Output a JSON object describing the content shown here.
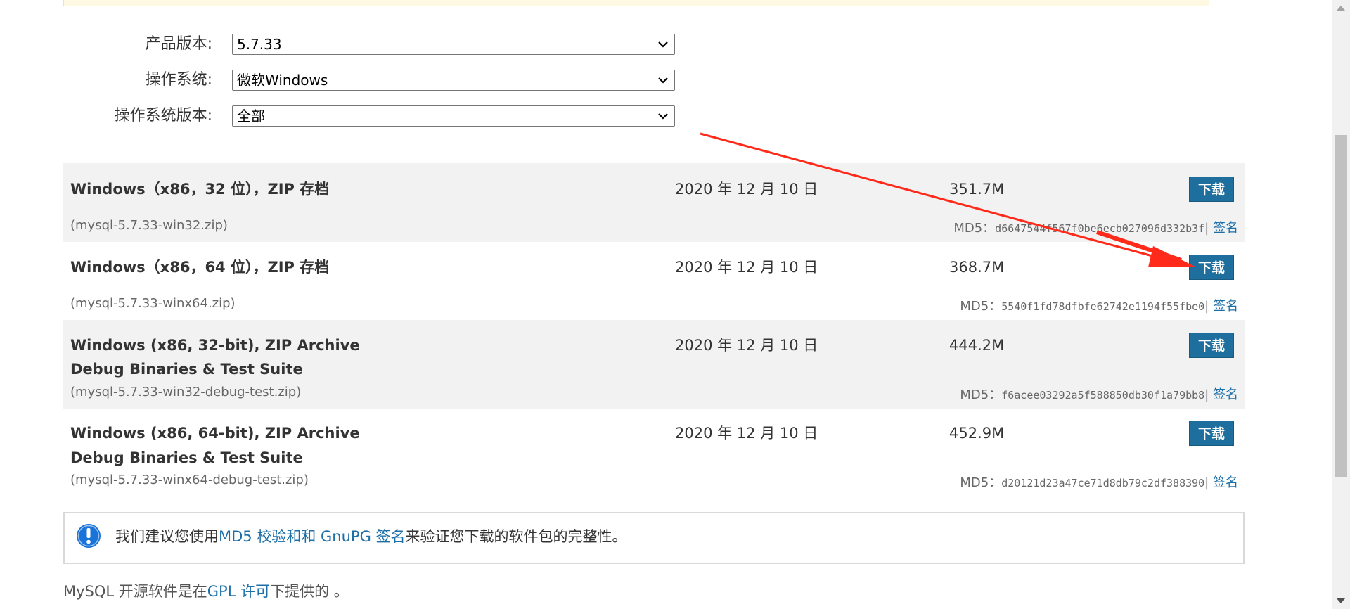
{
  "selectors": [
    {
      "label": "产品版本:",
      "value": "5.7.33"
    },
    {
      "label": "操作系统:",
      "value": "微软Windows"
    },
    {
      "label": "操作系统版本:",
      "value": "全部"
    }
  ],
  "downloads": [
    {
      "title_line1": "Windows（x86，32 位），ZIP 存档",
      "title_line2": "",
      "filename": "(mysql-5.7.33-win32.zip)",
      "date": "2020 年 12 月 10 日",
      "size": "351.7M",
      "button": "下载",
      "md5_label": "MD5：",
      "md5": "d6647544f567f0be6ecb027096d332b3f",
      "sep": "|",
      "signature": "签名"
    },
    {
      "title_line1": "Windows（x86，64 位），ZIP 存档",
      "title_line2": "",
      "filename": "(mysql-5.7.33-winx64.zip)",
      "date": "2020 年 12 月 10 日",
      "size": "368.7M",
      "button": "下载",
      "md5_label": "MD5：",
      "md5": "5540f1fd78dfbfe62742e1194f55fbe0",
      "sep": "|",
      "signature": "签名"
    },
    {
      "title_line1": "Windows (x86, 32-bit), ZIP Archive",
      "title_line2": "Debug Binaries & Test Suite",
      "filename": "(mysql-5.7.33-win32-debug-test.zip)",
      "date": "2020 年 12 月 10 日",
      "size": "444.2M",
      "button": "下载",
      "md5_label": "MD5：",
      "md5": "f6acee03292a5f588850db30f1a79bb8",
      "sep": "|",
      "signature": "签名"
    },
    {
      "title_line1": "Windows (x86, 64-bit), ZIP Archive",
      "title_line2": "Debug Binaries & Test Suite",
      "filename": "(mysql-5.7.33-winx64-debug-test.zip)",
      "date": "2020 年 12 月 10 日",
      "size": "452.9M",
      "button": "下载",
      "md5_label": "MD5：",
      "md5": "d20121d23a47ce71d8db79c2df388390",
      "sep": "|",
      "signature": "签名"
    }
  ],
  "info": {
    "icon": "info-exclamation-icon",
    "prefix": "我们建议您使用",
    "link1": "MD5 校验和",
    "middle": "和 ",
    "link2": "GnuPG 签名",
    "suffix": "来验证您下载的软件包的完整性。"
  },
  "footer": {
    "prefix": "MySQL 开源软件是在",
    "link": "GPL 许可",
    "suffix": "下提供的 。"
  },
  "colors": {
    "button": "#1f6f9e",
    "link": "#1c6fa8",
    "row_shade": "#f2f2f2",
    "annotation_arrow": "#ff2a1a",
    "info_icon": "#1a73d9"
  }
}
